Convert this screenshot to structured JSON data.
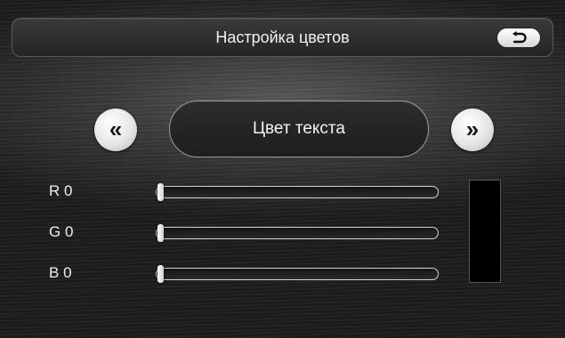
{
  "header": {
    "title": "Настройка цветов",
    "back_icon": "return-arrow-icon"
  },
  "selector": {
    "current": "Цвет текста",
    "prev_symbol": "«",
    "next_symbol": "»",
    "prev_icon": "double-chevron-left-icon",
    "next_icon": "double-chevron-right-icon"
  },
  "sliders": [
    {
      "channel": "R",
      "value": "0",
      "fraction": 0
    },
    {
      "channel": "G",
      "value": "0",
      "fraction": 0
    },
    {
      "channel": "B",
      "value": "0",
      "fraction": 0
    }
  ],
  "preview": {
    "color": "#000000"
  }
}
